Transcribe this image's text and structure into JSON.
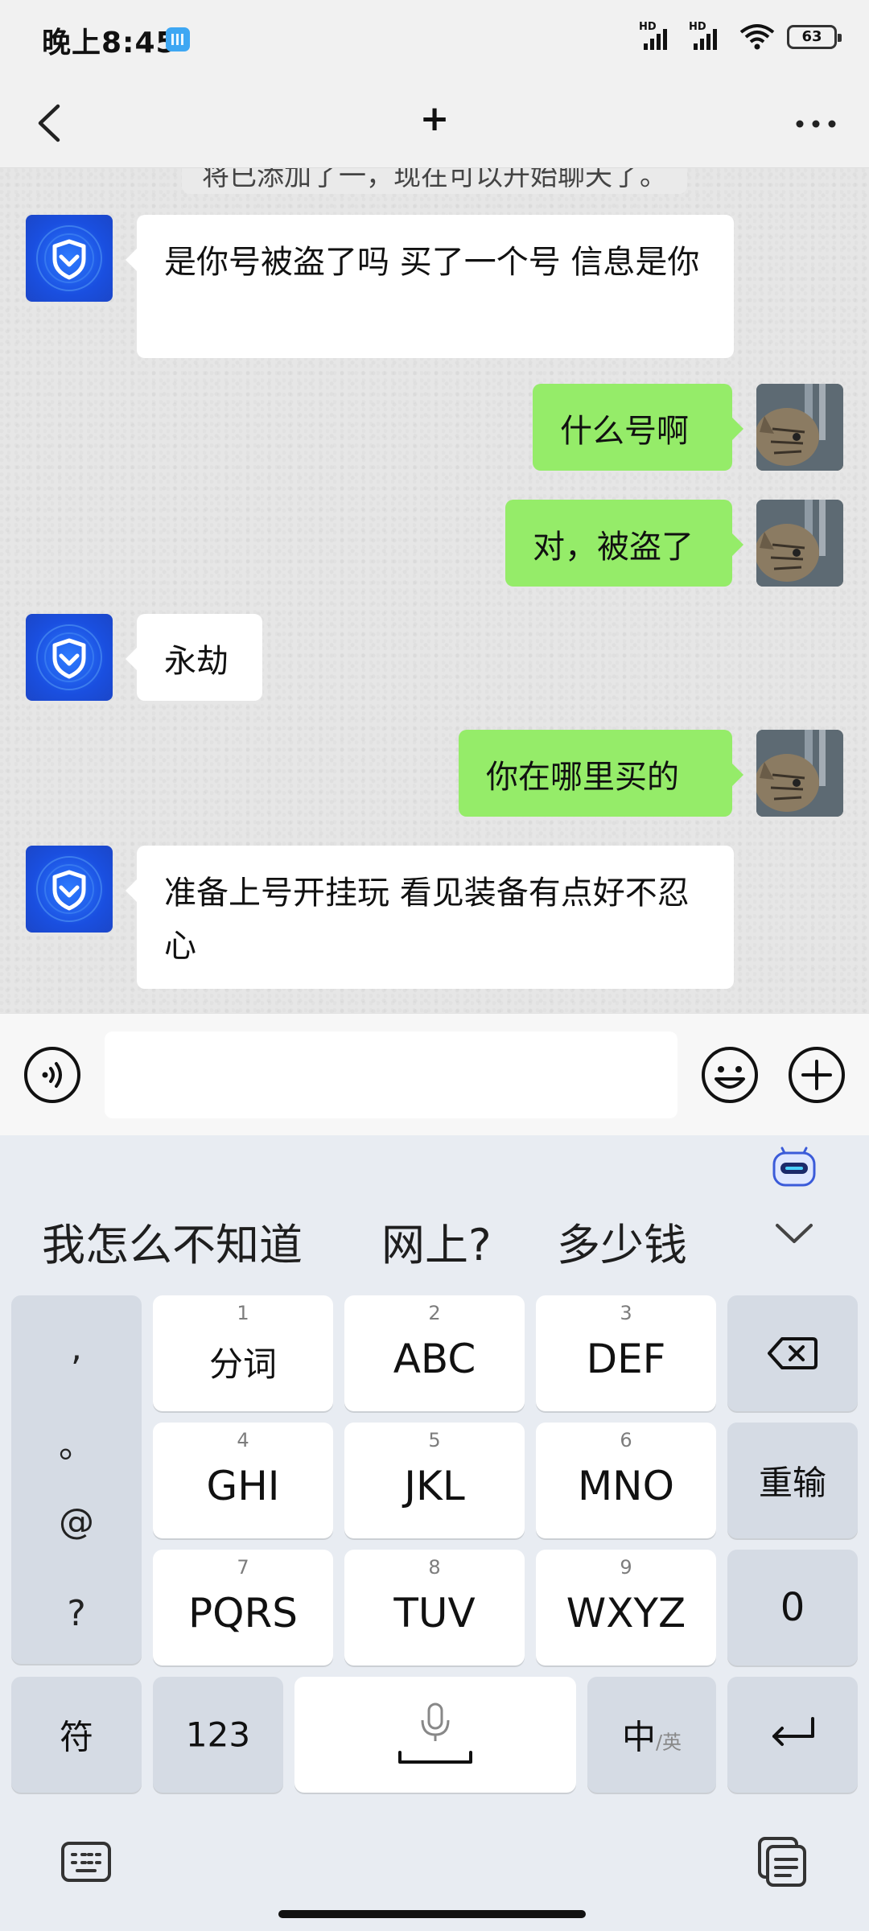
{
  "status_bar": {
    "time": "晚上8:45",
    "hd1": "HD",
    "hd2": "HD",
    "battery": "63"
  },
  "header": {
    "title": "+"
  },
  "chat": {
    "system_text": "将已添加了一，现在可以开始聊天了。",
    "messages": [
      {
        "side": "in",
        "text": "是你号被盗了吗 买了一个号 信息是你"
      },
      {
        "side": "out",
        "text": "什么号啊"
      },
      {
        "side": "out",
        "text": "对，被盗了"
      },
      {
        "side": "in",
        "text": "永劫"
      },
      {
        "side": "out",
        "text": "你在哪里买的"
      },
      {
        "side": "in",
        "text": "准备上号开挂玩 看见装备有点好不忍心"
      }
    ]
  },
  "input_bar": {
    "placeholder": ""
  },
  "keyboard": {
    "suggestions": [
      "我怎么不知道",
      "网上?",
      "多少钱"
    ],
    "punct": [
      ",",
      "。",
      "@",
      "?"
    ],
    "keys": [
      {
        "num": "1",
        "label": "分词"
      },
      {
        "num": "2",
        "label": "ABC"
      },
      {
        "num": "3",
        "label": "DEF"
      },
      {
        "num": "4",
        "label": "GHI"
      },
      {
        "num": "5",
        "label": "JKL"
      },
      {
        "num": "6",
        "label": "MNO"
      },
      {
        "num": "7",
        "label": "PQRS"
      },
      {
        "num": "8",
        "label": "TUV"
      },
      {
        "num": "9",
        "label": "WXYZ"
      }
    ],
    "reset_label": "重输",
    "zero_label": "0",
    "symbol_label": "符",
    "num_label": "123",
    "lang_main": "中",
    "lang_sub": "/英"
  },
  "icons": {
    "back": "chevron-left-icon",
    "more": "more-icon",
    "voice": "voice-icon",
    "emoji": "emoji-icon",
    "plus": "plus-icon",
    "backspace": "backspace-icon",
    "mic": "mic-icon",
    "enter": "enter-icon",
    "keyboard": "keyboard-icon",
    "clipboard": "clipboard-icon"
  },
  "colors": {
    "outgoing_bubble": "#95ec69",
    "incoming_bubble": "#ffffff",
    "bot_avatar": "#1a4fe0"
  }
}
